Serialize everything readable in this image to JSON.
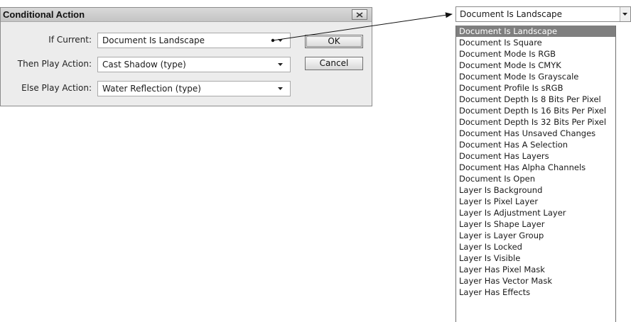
{
  "dialog": {
    "title": "Conditional Action",
    "rows": [
      {
        "label": "If Current:",
        "value": "Document Is Landscape"
      },
      {
        "label": "Then Play Action:",
        "value": "Cast Shadow (type)"
      },
      {
        "label": "Else Play Action:",
        "value": "Water Reflection (type)"
      }
    ],
    "ok_label": "OK",
    "cancel_label": "Cancel"
  },
  "dropdown": {
    "selected": "Document Is Landscape",
    "options": [
      "Document Is Landscape",
      "Document Is Square",
      "Document Mode Is RGB",
      "Document Mode Is CMYK",
      "Document Mode Is Grayscale",
      "Document Profile Is sRGB",
      "Document Depth Is 8 Bits Per Pixel",
      "Document Depth Is 16 Bits Per Pixel",
      "Document Depth Is 32 Bits Per Pixel",
      "Document Has Unsaved Changes",
      "Document Has A Selection",
      "Document Has Layers",
      "Document Has Alpha Channels",
      "Document Is Open",
      "Layer Is Background",
      "Layer Is Pixel Layer",
      "Layer Is Adjustment Layer",
      "Layer Is Shape Layer",
      "Layer is Layer Group",
      "Layer Is Locked",
      "Layer Is Visible",
      "Layer Has Pixel Mask",
      "Layer Has Vector Mask",
      "Layer Has Effects"
    ]
  }
}
